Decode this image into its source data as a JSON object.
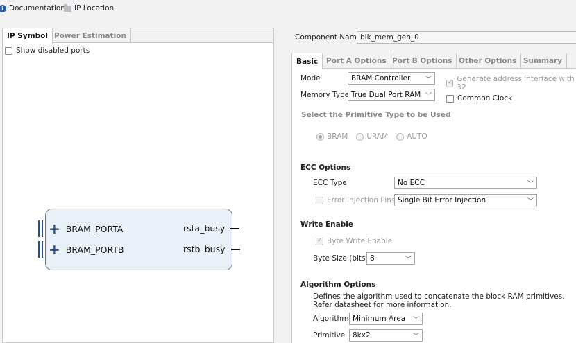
{
  "toolbar": {
    "documentation": "Documentation",
    "ip_location": "IP Location"
  },
  "left": {
    "tabs": [
      "IP Symbol",
      "Power Estimation"
    ],
    "show_disabled_ports": "Show disabled ports",
    "symbol": {
      "ports_in": [
        "BRAM_PORTA",
        "BRAM_PORTB"
      ],
      "ports_out": [
        "rsta_busy",
        "rstb_busy"
      ]
    }
  },
  "right": {
    "component_name_label": "Component Name",
    "component_name_value": "blk_mem_gen_0",
    "tabs": [
      "Basic",
      "Port A Options",
      "Port B Options",
      "Other Options",
      "Summary"
    ],
    "mode_label": "Mode",
    "mode_value": "BRAM Controller",
    "memory_type_label": "Memory Type",
    "memory_type_value": "True Dual Port RAM",
    "generate_address": "Generate address interface with 32",
    "common_clock": "Common Clock",
    "primitive_type_title": "Select the Primitive Type to be Used",
    "primitive_options": [
      "BRAM",
      "URAM",
      "AUTO"
    ],
    "ecc_title": "ECC Options",
    "ecc_type_label": "ECC Type",
    "ecc_type_value": "No ECC",
    "error_injection_label": "Error Injection Pins",
    "error_injection_value": "Single Bit Error Injection",
    "write_enable_title": "Write Enable",
    "byte_write_enable": "Byte Write Enable",
    "byte_size_label": "Byte Size (bits)",
    "byte_size_value": "8",
    "algorithm_title": "Algorithm Options",
    "algorithm_desc_1": "Defines the algorithm used to concatenate the block RAM primitives.",
    "algorithm_desc_2": "Refer datasheet for more information.",
    "algorithm_label": "Algorithm",
    "algorithm_value": "Minimum Area",
    "primitive_label": "Primitive",
    "primitive_value": "8kx2"
  },
  "colors": {
    "symbol_fill": "#e9f0f8",
    "symbol_border": "#6b7a8c",
    "port_blue": "#2a4f7a",
    "info_icon": "#2a5ea8"
  }
}
